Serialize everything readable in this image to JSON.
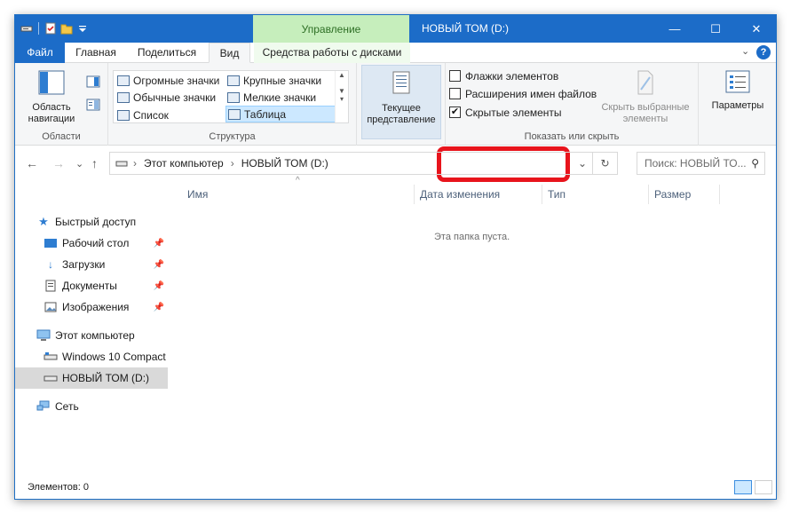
{
  "titlebar": {
    "context_tab": "Управление",
    "title": "НОВЫЙ ТОМ (D:)",
    "minimize": "—",
    "maximize": "☐",
    "close": "✕"
  },
  "tabs": {
    "file": "Файл",
    "home": "Главная",
    "share": "Поделиться",
    "view": "Вид",
    "drive_tools": "Средства работы с дисками",
    "help": "?",
    "collapse": "⌄"
  },
  "ribbon": {
    "panes": {
      "label": "Области",
      "nav_pane": "Область навигации"
    },
    "layout": {
      "label": "Структура",
      "items": [
        "Огромные значки",
        "Крупные значки",
        "Обычные значки",
        "Мелкие значки",
        "Список",
        "Таблица"
      ],
      "selected": "Таблица"
    },
    "current_view": {
      "label": "Текущее представление"
    },
    "show_hide": {
      "label": "Показать или скрыть",
      "checkbox_item": "Флажки элементов",
      "checkbox_item_checked": false,
      "extensions": "Расширения имен файлов",
      "extensions_checked": false,
      "hidden": "Скрытые элементы",
      "hidden_checked": true,
      "hide_selected": "Скрыть выбранные элементы"
    },
    "options": {
      "label": "Параметры"
    }
  },
  "address": {
    "path_root": "Этот компьютер",
    "path_current": "НОВЫЙ ТОМ (D:)",
    "search_placeholder": "Поиск: НОВЫЙ ТО..."
  },
  "nav": {
    "quick_access": "Быстрый доступ",
    "pinned": [
      "Рабочий стол",
      "Загрузки",
      "Документы",
      "Изображения"
    ],
    "this_pc": "Этот компьютер",
    "drives": [
      "Windows 10 Compact",
      "НОВЫЙ ТОМ (D:)"
    ],
    "selected_drive": "НОВЫЙ ТОМ (D:)",
    "network": "Сеть"
  },
  "columns": [
    "Имя",
    "Дата изменения",
    "Тип",
    "Размер"
  ],
  "sort_indicator": "^",
  "empty_text": "Эта папка пуста.",
  "status": {
    "items_text": "Элементов: 0"
  },
  "colors": {
    "accent": "#1c6cc8",
    "context_tab": "#c6eebc",
    "highlight": "#e8141c"
  }
}
